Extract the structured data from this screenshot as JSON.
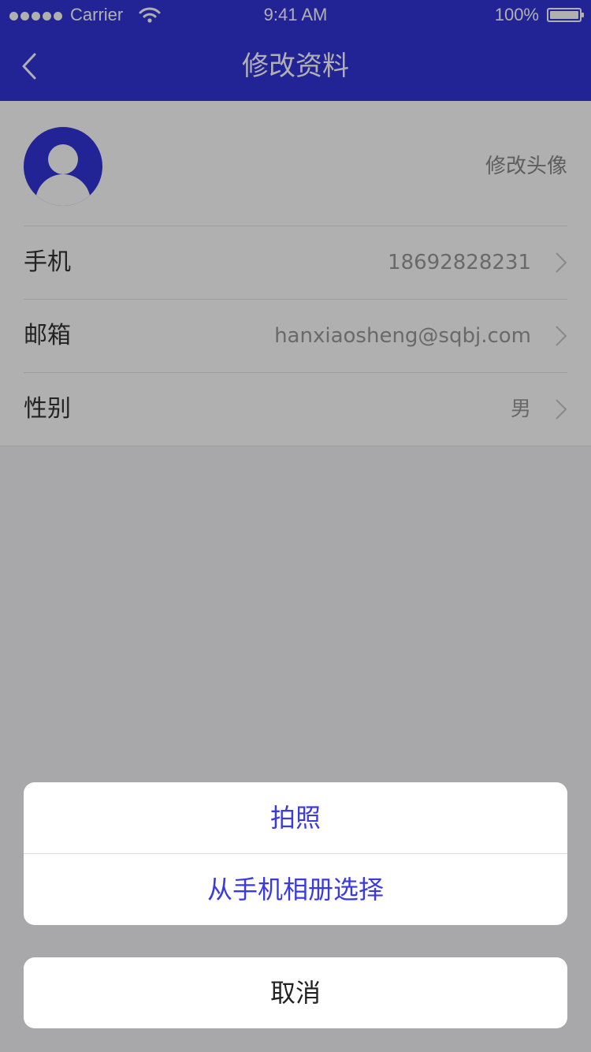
{
  "status_bar": {
    "carrier": "Carrier",
    "time": "9:41 AM",
    "battery": "100%"
  },
  "nav": {
    "title": "修改资料",
    "back_icon": "chevron-left-icon"
  },
  "profile": {
    "avatar_icon": "user-avatar-icon",
    "edit_avatar_label": "修改头像",
    "rows": [
      {
        "label": "手机",
        "value": "18692828231"
      },
      {
        "label": "邮箱",
        "value": "hanxiaosheng@sqbj.com"
      },
      {
        "label": "性别",
        "value": "男"
      }
    ]
  },
  "action_sheet": {
    "options": [
      {
        "label": "拍照"
      },
      {
        "label": "从手机相册选择"
      }
    ],
    "cancel_label": "取消"
  },
  "colors": {
    "brand": "#3235d8",
    "action_text": "#3a3ae0"
  }
}
